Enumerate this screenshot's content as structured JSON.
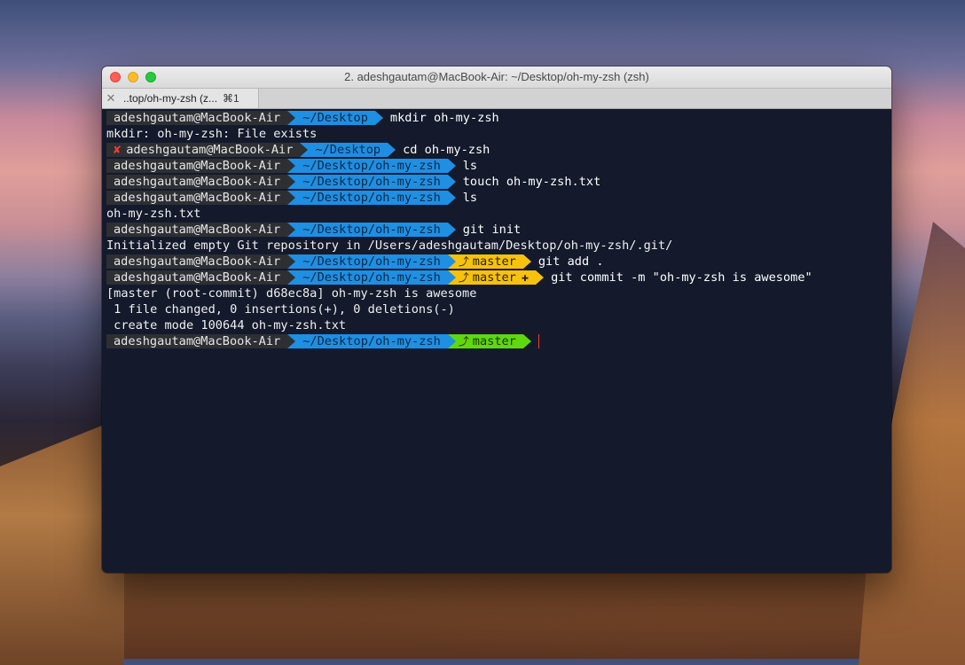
{
  "window": {
    "title": "2. adeshgautam@MacBook-Air: ~/Desktop/oh-my-zsh (zsh)"
  },
  "tab": {
    "label": "..top/oh-my-zsh (z...",
    "shortcut": "⌘1"
  },
  "prompt": {
    "user_host": "adeshgautam@MacBook-Air",
    "branch": "master",
    "fail_glyph": "✘",
    "branch_glyph": "⤴",
    "dirty_glyph": "✚"
  },
  "lines": [
    {
      "dir": "~/Desktop",
      "cmd": "mkdir oh-my-zsh"
    },
    {
      "output": "mkdir: oh-my-zsh: File exists"
    },
    {
      "dir": "~/Desktop",
      "cmd": "cd oh-my-zsh"
    },
    {
      "dir": "~/Desktop/oh-my-zsh",
      "cmd": "ls"
    },
    {
      "dir": "~/Desktop/oh-my-zsh",
      "cmd": "touch oh-my-zsh.txt"
    },
    {
      "dir": "~/Desktop/oh-my-zsh",
      "cmd": "ls"
    },
    {
      "output": "oh-my-zsh.txt"
    },
    {
      "dir": "~/Desktop/oh-my-zsh",
      "cmd": "git init"
    },
    {
      "output": "Initialized empty Git repository in /Users/adeshgautam/Desktop/oh-my-zsh/.git/"
    },
    {
      "dir": "~/Desktop/oh-my-zsh",
      "cmd": "git add ."
    },
    {
      "dir": "~/Desktop/oh-my-zsh",
      "cmd": "git commit -m \"oh-my-zsh is awesome\""
    },
    {
      "output": "[master (root-commit) d68ec8a] oh-my-zsh is awesome"
    },
    {
      "output": " 1 file changed, 0 insertions(+), 0 deletions(-)"
    },
    {
      "output": " create mode 100644 oh-my-zsh.txt"
    },
    {
      "dir": "~/Desktop/oh-my-zsh",
      "cmd": ""
    }
  ],
  "colors": {
    "user_segment": "#2d2f33",
    "dir_segment": "#1e8fe3",
    "git_dirty": "#f7c20c",
    "git_clean": "#5fd80f",
    "terminal_bg": "#141a2c",
    "error": "#ff3b30"
  }
}
